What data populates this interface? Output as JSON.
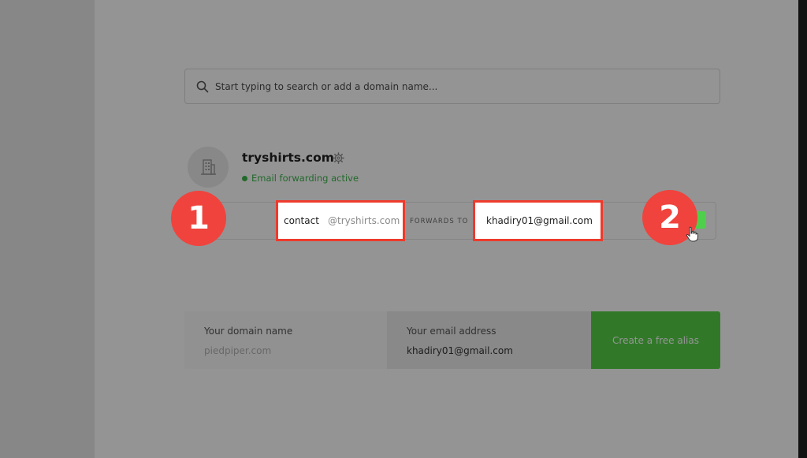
{
  "search": {
    "placeholder": "Start typing to search or add a domain name..."
  },
  "domain": {
    "name": "tryshirts.com",
    "status": "Email forwarding active",
    "icon": "building-icon"
  },
  "forwarding": {
    "alias_value": "contact",
    "alias_suffix": "@tryshirts.com",
    "forwards_label": "FORWARDS TO",
    "destination_value": "khadiry01@gmail.com"
  },
  "annotations": {
    "step1": "1",
    "step2": "2"
  },
  "bottom_form": {
    "domain_label": "Your domain name",
    "domain_placeholder": "piedpiper.com",
    "email_label": "Your email address",
    "email_value": "khadiry01@gmail.com",
    "button_label": "Create a free alias"
  },
  "colors": {
    "accent_green": "#55d147",
    "status_green": "#3bb54a",
    "highlight_red": "#ee3a2c",
    "badge_red": "#f0433d"
  }
}
